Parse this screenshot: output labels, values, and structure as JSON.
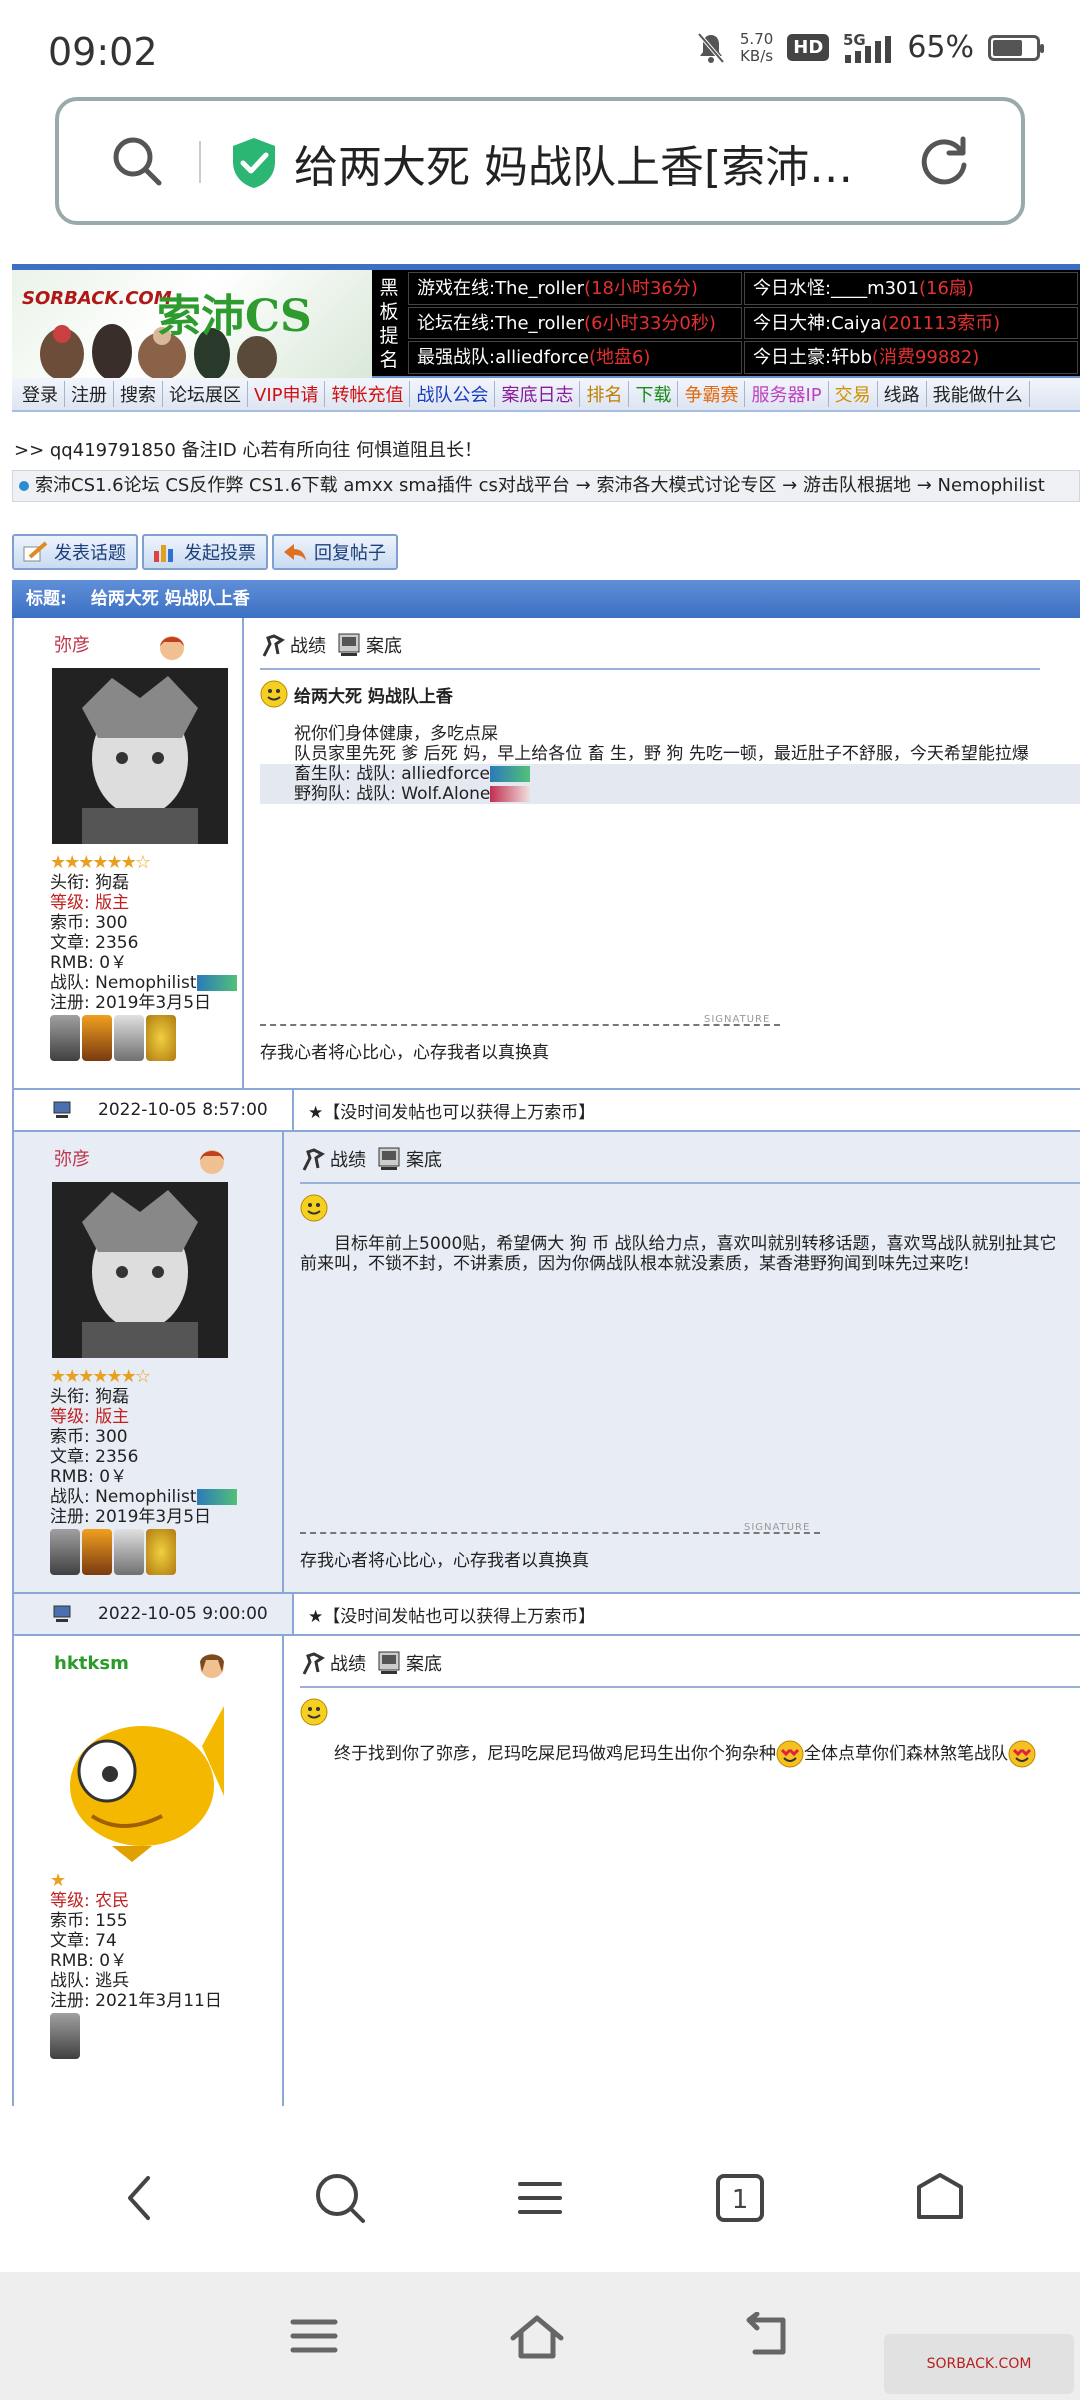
{
  "status_bar": {
    "time": "09:02",
    "speed_value": "5.70",
    "speed_unit": "KB/s",
    "hd": "HD",
    "signal": "5G",
    "battery_percent": "65%",
    "battery_level": 0.65
  },
  "address_bar": {
    "title": "给两大死 妈战队上香[索沛C…"
  },
  "forum": {
    "logo_text": "SORBACK.COM",
    "logo_cs": "索沛CS",
    "board_label": "黑板提名",
    "board": [
      {
        "label": "游戏在线:The_roller",
        "extra": "(18小时36分)"
      },
      {
        "label": "今日水怪:____m301",
        "extra": "(16扇)"
      },
      {
        "label": "论坛在线:The_roller",
        "extra": "(6小时33分0秒)"
      },
      {
        "label": "今日大神:Caiya",
        "extra": "(201113索币)"
      },
      {
        "label": "最强战队:alliedforce",
        "extra": "(地盘6)"
      },
      {
        "label": "今日土豪:轩bb",
        "extra": "(消费99882)"
      }
    ],
    "nav": [
      {
        "label": "登录",
        "color": "#222222"
      },
      {
        "label": "注册",
        "color": "#222222"
      },
      {
        "label": "搜索",
        "color": "#222222"
      },
      {
        "label": "论坛展区",
        "color": "#222222"
      },
      {
        "label": "VIP申请",
        "color": "#d01010"
      },
      {
        "label": "转帐充值",
        "color": "#d01010"
      },
      {
        "label": "战队公会",
        "color": "#1a3cc0"
      },
      {
        "label": "案底日志",
        "color": "#8a1a9a"
      },
      {
        "label": "排名",
        "color": "#c08000"
      },
      {
        "label": "下载",
        "color": "#1a8a1a"
      },
      {
        "label": "争霸赛",
        "color": "#e06a10"
      },
      {
        "label": "服务器IP",
        "color": "#c040c0"
      },
      {
        "label": "交易",
        "color": "#d09000"
      },
      {
        "label": "线路",
        "color": "#222222"
      },
      {
        "label": "我能做什么",
        "color": "#222222"
      }
    ],
    "notice": ">> qq419791850 备注ID 心若有所向往 何惧道阻且长！",
    "breadcrumb": "索沛CS1.6论坛 CS反作弊 CS1.6下载 amxx sma插件 cs对战平台 → 索沛各大模式讨论专区 → 游击队根据地 → Nemophilist",
    "buttons": {
      "new_topic": "发表话题",
      "new_poll": "发起投票",
      "reply": "回复帖子"
    },
    "title_label": "标题:",
    "thread_title": "给两大死 妈战队上香",
    "tools": {
      "stats": "战绩",
      "record": "案底"
    },
    "signature_tag": "SIGNATURE",
    "posts": [
      {
        "user": "弥彦",
        "stars": "★★★★★★☆",
        "title_label": "头衔: 狗磊",
        "level": "等级: 版主",
        "coins": "索币: 300",
        "articles": "文章: 2356",
        "rmb": "RMB: 0￥",
        "team": "战队: Nemophilist",
        "registered": "注册: 2019年3月5日",
        "post_title": "给两大死 妈战队上香",
        "lines": [
          "祝你们身体健康，多吃点屎",
          "队员家里先死 爹 后死 妈，早上给各位 畜 生，野 狗 先吃一顿，最近肚子不舒服，今天希望能拉爆"
        ],
        "team_lines": [
          "畜生队: 战队: alliedforce",
          "野狗队: 战队: Wolf.Alone"
        ],
        "signature": "存我心者将心比心，心存我者以真换真",
        "time": "2022-10-05 8:57:00",
        "footer": "★【没时间发帖也可以获得上万索币】"
      },
      {
        "user": "弥彦",
        "stars": "★★★★★★☆",
        "title_label": "头衔: 狗磊",
        "level": "等级: 版主",
        "coins": "索币: 300",
        "articles": "文章: 2356",
        "rmb": "RMB: 0￥",
        "team": "战队: Nemophilist",
        "registered": "注册: 2019年3月5日",
        "lines": [
          "目标年前上5000贴，希望俩大 狗 币 战队给力点，喜欢叫就别转移话题，喜欢骂战队就别扯其它",
          "前来叫，不锁不封，不讲素质，因为你俩战队根本就没素质，某香港野狗闻到味先过来吃!"
        ],
        "signature": "存我心者将心比心，心存我者以真换真",
        "time": "2022-10-05 9:00:00",
        "footer": "★【没时间发帖也可以获得上万索币】"
      },
      {
        "user": "hktksm",
        "stars": "★",
        "level": "等级: 农民",
        "coins": "索币: 155",
        "articles": "文章: 74",
        "rmb": "RMB: 0￥",
        "team": "战队: 逃兵",
        "registered": "注册: 2021年3月11日",
        "lines": [
          "终于找到你了弥彦，尼玛吃屎尼玛做鸡尼玛生出你个狗杂种",
          "全体点草你们森林煞笔战队"
        ]
      }
    ]
  },
  "browser_bar": {
    "tab_count": "1"
  },
  "watermark": "SORBACK.COM"
}
